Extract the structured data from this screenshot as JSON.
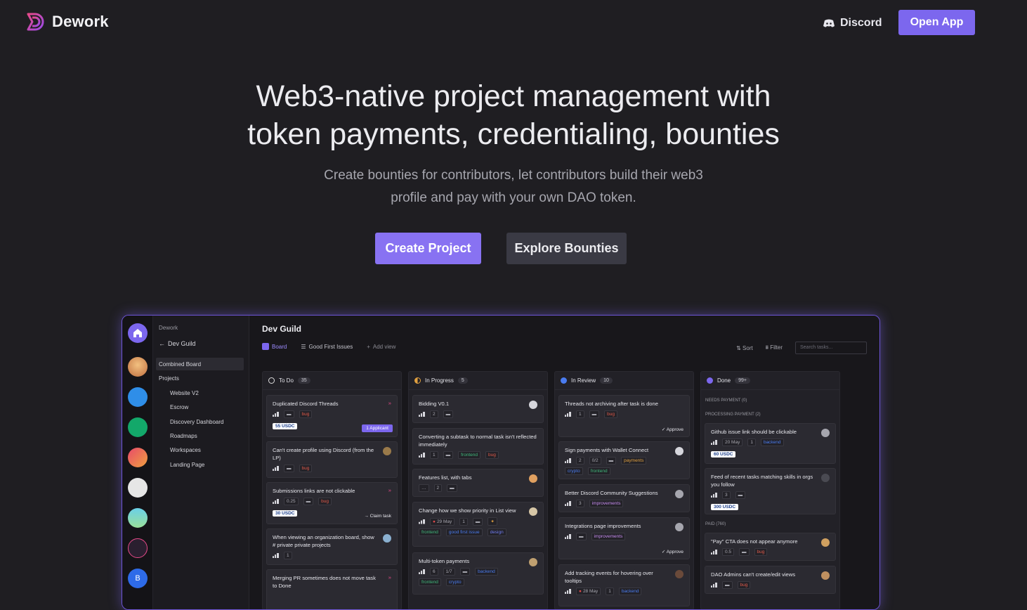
{
  "nav": {
    "brand": "Dework",
    "discord_label": "Discord",
    "open_app_label": "Open App"
  },
  "hero": {
    "title_line1": "Web3-native project management with",
    "title_line2": "token payments, credentialing, bounties",
    "subtitle_line1": "Create bounties for contributors, let contributors build their web3",
    "subtitle_line2": "profile and pay with your own DAO token.",
    "create_label": "Create Project",
    "explore_label": "Explore Bounties"
  },
  "app": {
    "sidebar": {
      "org": "Dework",
      "back_title": "Dev Guild",
      "combined": "Combined Board",
      "projects_label": "Projects",
      "projects": [
        "Website V2",
        "Escrow",
        "Discovery Dashboard",
        "Roadmaps",
        "Workspaces",
        "Landing Page"
      ]
    },
    "header": {
      "title": "Dev Guild",
      "tab_board": "Board",
      "tab_gfi": "Good First Issues",
      "add_view": "Add view",
      "sort": "Sort",
      "filter": "Filter",
      "search_placeholder": "Search tasks..."
    },
    "columns": [
      {
        "title": "To Do",
        "count": "35"
      },
      {
        "title": "In Progress",
        "count": "5"
      },
      {
        "title": "In Review",
        "count": "10"
      },
      {
        "title": "Done",
        "count": "99+"
      }
    ],
    "todo": {
      "c1_title": "Duplicated Discord Threads",
      "c1_tag": "bug",
      "c1_reward": "55 USDC",
      "c1_applicant": "1 Applicant",
      "c2_title": "Can't create profile using Discord (from the LP)",
      "c2_tag": "bug",
      "c3_title": "Submissions links are not clickable",
      "c3_points": "0.25",
      "c3_tag": "bug",
      "c3_reward": "30 USDC",
      "c3_claim": "Claim task",
      "c4_title": "When viewing an organization board, show # private private projects",
      "c4_sub": "1",
      "c5_title": "Merging PR sometimes does not move task to Done"
    },
    "progress": {
      "c1_title": "Bidding V0.1",
      "c1_sub": "2",
      "c2_title": "Converting a subtask to normal task isn't reflected immediately",
      "c2_sub": "1",
      "c2_tag1": "frontend",
      "c2_tag2": "bug",
      "c3_title": "Features list, with tabs",
      "c3_sub": "2",
      "c4_title": "Change how we show priority in List view",
      "c4_date": "29 May",
      "c4_sub": "1",
      "c4_tag1": "frontend",
      "c4_tag2": "good first issue",
      "c4_tag3": "design",
      "c5_title": "Multi-token payments",
      "c5_sub": "6",
      "c5_prog": "1/7",
      "c5_tag1": "backend",
      "c5_tag2": "frontend",
      "c5_tag3": "crypto"
    },
    "review": {
      "c1_title": "Threads not archiving after task is done",
      "c1_sub": "1",
      "c1_tag": "bug",
      "c1_approve": "Approve",
      "c2_title": "Sign payments with Wallet Connect",
      "c2_sub": "2",
      "c2_prog": "0/2",
      "c2_tag1": "payments",
      "c2_tag2": "crypto",
      "c2_tag3": "frontend",
      "c3_title": "Better Discord Community Suggestions",
      "c3_sub": "3",
      "c3_tag": "improvements",
      "c4_title": "Integrations page improvements",
      "c4_tag": "improvements",
      "c4_approve": "Approve",
      "c5_title": "Add tracking events for hovering over tooltips",
      "c5_date": "28 May",
      "c5_sub": "1",
      "c5_tag": "backend"
    },
    "done": {
      "g1": "NEEDS PAYMENT (0)",
      "g2": "PROCESSING PAYMENT (2)",
      "c1_title": "Github issue link should be clickable",
      "c1_date": "20 May",
      "c1_sub": "1",
      "c1_tag": "backend",
      "c1_reward": "60 USDC",
      "c2_title": "Feed of recent tasks matching skills in orgs you follow",
      "c2_sub": "3",
      "c2_reward": "300 USDC",
      "g3": "PAID (760)",
      "c3_title": "\"Pay\" CTA does not appear anymore",
      "c3_points": "0.5",
      "c3_tag": "bug",
      "c4_title": "DAO Admins can't create/edit views",
      "c4_tag": "bug"
    }
  }
}
